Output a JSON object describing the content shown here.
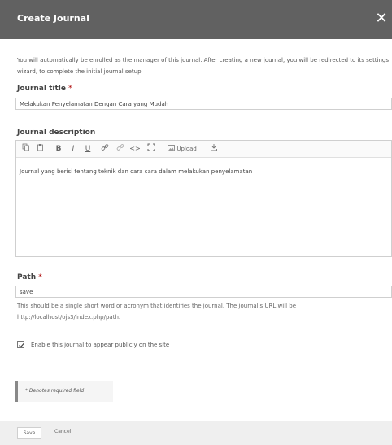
{
  "header": {
    "title": "Create Journal",
    "close_glyph": "✕"
  },
  "intro": "You will automatically be enrolled as the manager of this journal. After creating a new journal, you will be redirected to its settings wizard, to complete the initial journal setup.",
  "journal_title": {
    "label": "Journal title",
    "required_mark": "*",
    "value": "Melakukan Penyelamatan Dengan Cara yang Mudah"
  },
  "journal_description": {
    "label": "Journal description",
    "toolbar": {
      "copy_icon": "copy-icon",
      "paste_icon": "paste-icon",
      "bold": "B",
      "italic": "I",
      "underline": "U",
      "link_icon": "link-icon",
      "unlink_icon": "unlink-icon",
      "code": "<>",
      "fullscreen_icon": "fullscreen-icon",
      "upload_label": "Upload",
      "download_icon": "download-icon"
    },
    "body_text": "Journal yang berisi tentang teknik dan cara cara dalam melakukan penyelamatan"
  },
  "path": {
    "label": "Path",
    "required_mark": "*",
    "value": "save",
    "hint": "This should be a single short word or acronym that identifies the journal. The journal's URL will be http://localhost/ojs3/index.php/path."
  },
  "enable": {
    "label": "Enable this journal to appear publicly on the site",
    "checked": true
  },
  "required_note": "* Denotes required field",
  "footer": {
    "save_label": "Save",
    "cancel_label": "Cancel"
  },
  "colors": {
    "header_bg": "#616161",
    "required": "#aa0000"
  }
}
